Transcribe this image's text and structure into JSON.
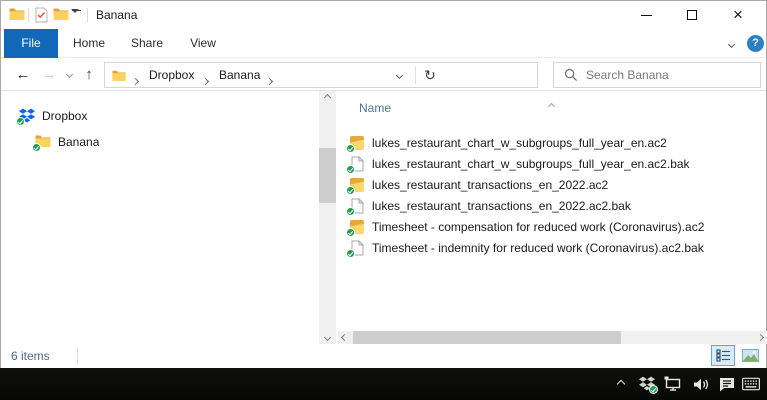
{
  "window": {
    "title": "Banana"
  },
  "glyphs": {
    "back": "←",
    "forward": "→",
    "up": "↑",
    "refresh": "↻",
    "close": "×",
    "help": "?"
  },
  "ribbon": {
    "active_tab": "File",
    "tabs": [
      {
        "label": "File"
      },
      {
        "label": "Home"
      },
      {
        "label": "Share"
      },
      {
        "label": "View"
      }
    ]
  },
  "address_bar": {
    "crumbs": [
      {
        "label": "Dropbox"
      },
      {
        "label": "Banana"
      }
    ]
  },
  "search": {
    "placeholder": "Search Banana"
  },
  "sidebar": {
    "items": [
      {
        "label": "Dropbox",
        "icon": "dropbox-icon",
        "sync": "synced"
      },
      {
        "label": "Banana",
        "icon": "folder-icon",
        "sync": "synced"
      }
    ]
  },
  "file_list": {
    "column_header": "Name",
    "sort_direction": "ascending",
    "items": [
      {
        "name": "lukes_restaurant_chart_w_subgroups_full_year_en.ac2",
        "icon": "ac2-file-icon",
        "sync": "synced"
      },
      {
        "name": "lukes_restaurant_chart_w_subgroups_full_year_en.ac2.bak",
        "icon": "bak-file-icon",
        "sync": "synced"
      },
      {
        "name": "lukes_restaurant_transactions_en_2022.ac2",
        "icon": "ac2-file-icon",
        "sync": "synced"
      },
      {
        "name": "lukes_restaurant_transactions_en_2022.ac2.bak",
        "icon": "bak-file-icon",
        "sync": "synced"
      },
      {
        "name": "Timesheet - compensation for reduced work (Coronavirus).ac2",
        "icon": "ac2-file-icon",
        "sync": "synced"
      },
      {
        "name": "Timesheet - indemnity for reduced work (Coronavirus).ac2.bak",
        "icon": "bak-file-icon",
        "sync": "synced"
      }
    ]
  },
  "status_bar": {
    "item_count": "6 items"
  },
  "tray": {
    "icons": [
      "hidden-icons-chevron",
      "dropbox",
      "network",
      "volume",
      "action-center",
      "touch-keyboard"
    ]
  },
  "colors": {
    "accent_blue": "#1168b8",
    "sync_green": "#1d9e4f",
    "dropbox_blue": "#0062ff",
    "folder_yellow": "#fcd15e",
    "column_header_text": "#4f7296"
  }
}
